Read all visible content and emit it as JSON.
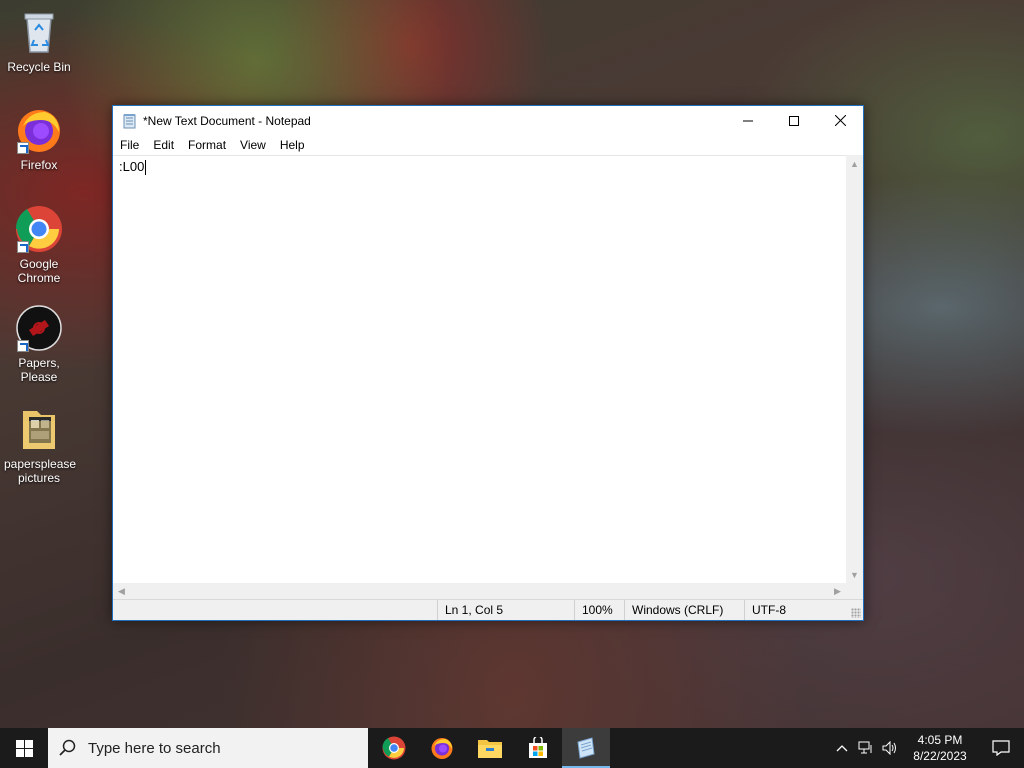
{
  "desktop": {
    "icons": [
      {
        "label": "Recycle Bin",
        "icon": "recycle-bin-icon"
      },
      {
        "label": "Firefox",
        "icon": "firefox-icon"
      },
      {
        "label": "Google Chrome",
        "icon": "chrome-icon"
      },
      {
        "label": "Papers, Please",
        "icon": "papers-please-icon"
      },
      {
        "label": "papersplease pictures",
        "icon": "folder-icon"
      }
    ]
  },
  "notepad": {
    "title": "*New Text Document - Notepad",
    "menu": [
      "File",
      "Edit",
      "Format",
      "View",
      "Help"
    ],
    "content": ":L00",
    "status": {
      "position": "Ln 1, Col 5",
      "zoom": "100%",
      "line_endings": "Windows (CRLF)",
      "encoding": "UTF-8"
    },
    "buttons": {
      "minimize": "—",
      "maximize": "☐",
      "close": "✕"
    }
  },
  "taskbar": {
    "search_placeholder": "Type here to search",
    "apps": [
      "chrome-icon",
      "firefox-icon",
      "file-explorer-icon",
      "store-icon",
      "notepad-icon"
    ],
    "clock_time": "4:05 PM",
    "clock_date": "8/22/2023"
  },
  "colors": {
    "accent": "#1f6fbf",
    "taskbar": "#1b1b1b",
    "active_indicator": "#76b9ed"
  }
}
